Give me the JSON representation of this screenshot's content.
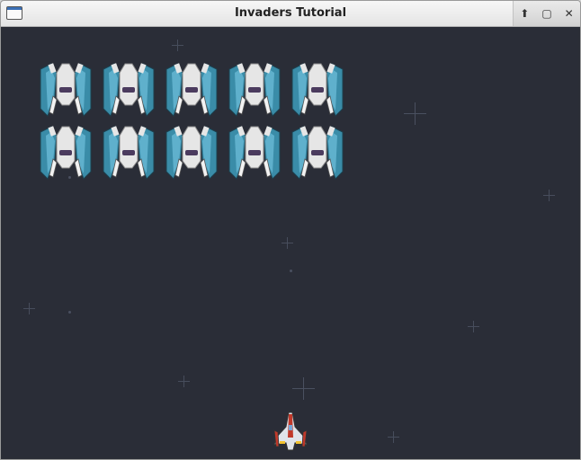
{
  "window": {
    "title": "Invaders Tutorial",
    "icon": "app-window-icon",
    "controls": [
      {
        "name": "shade-button",
        "glyph": "⬆"
      },
      {
        "name": "maximize-button",
        "glyph": "▢"
      },
      {
        "name": "close-button",
        "glyph": "✕"
      }
    ]
  },
  "game": {
    "invader_rows": 2,
    "invader_cols": 5,
    "invader_icon": "blue-invader-ship-icon",
    "player_icon": "red-player-ship-icon",
    "colors": {
      "background": "#2a2d37",
      "invader_wing": "#3a8ca8",
      "invader_body": "#e6e6e6",
      "player_accent": "#c0392b"
    }
  }
}
